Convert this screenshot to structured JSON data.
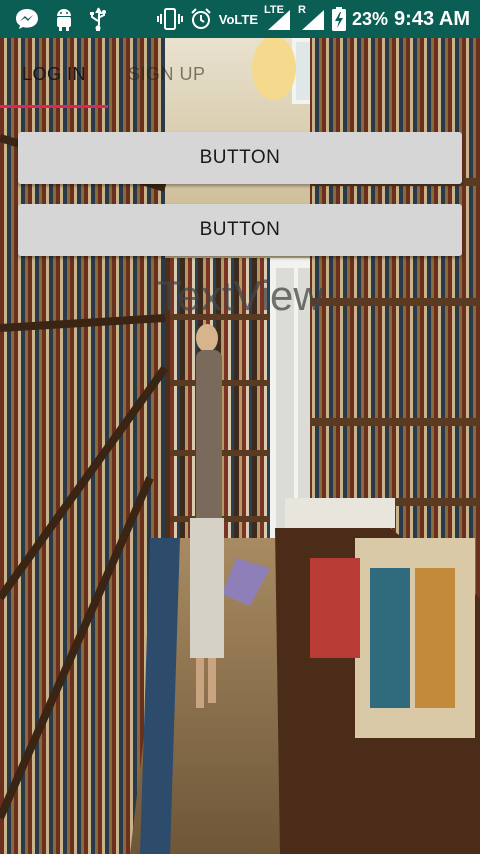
{
  "status_bar": {
    "volte_label": "VoLTE",
    "lte_label": "LTE",
    "roaming_label": "R",
    "battery_percent": "23%",
    "time": "9:43 AM",
    "icons": [
      "messenger-icon",
      "android-icon",
      "usb-icon",
      "vibrate-icon",
      "alarm-icon",
      "signal-icon",
      "battery-charging-icon"
    ]
  },
  "tabs": [
    {
      "label": "LOG IN",
      "selected": true
    },
    {
      "label": "SIGN UP",
      "selected": false
    }
  ],
  "buttons": [
    {
      "label": "BUTTON"
    },
    {
      "label": "BUTTON"
    }
  ],
  "text_view": "TextView",
  "colors": {
    "status_bar": "#0b5e54",
    "tab_indicator": "#e0245e",
    "button_bg": "#d6d6d6"
  }
}
